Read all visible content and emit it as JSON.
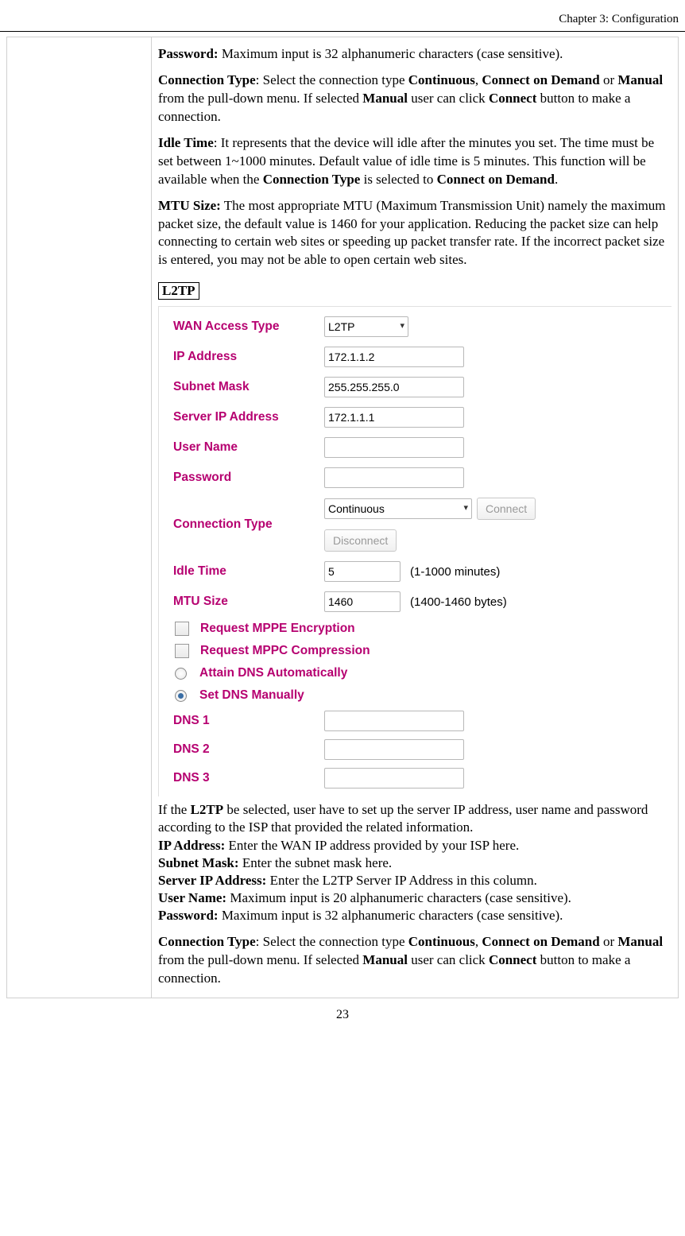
{
  "header": {
    "chapter": "Chapter 3: Configuration"
  },
  "top": {
    "password": {
      "label": "Password:",
      "text": " Maximum input is 32 alphanumeric characters (case sensitive)."
    },
    "conn_type": {
      "label": "Connection Type",
      "t1": ": Select the connection type ",
      "b1": "Continuous",
      "t2": ", ",
      "b2": "Connect on Demand",
      "t3": " or ",
      "b3": "Manual",
      "t4": " from the pull-down menu. If selected ",
      "b4": "Manual",
      "t5": " user can click ",
      "b5": "Connect",
      "t6": " button to make a connection."
    },
    "idle": {
      "label": "Idle Time",
      "t1": ": It represents that the device will idle after the minutes you set. The time must be set between 1~1000 minutes. Default value of idle time is 5 minutes. This function will be available when the ",
      "b1": "Connection Type",
      "t2": " is selected to ",
      "b2": "Connect on Demand",
      "t3": "."
    },
    "mtu": {
      "label": "MTU Size:",
      "t1": " The most appropriate MTU (Maximum Transmission Unit) namely the maximum packet size, the default value is 1460 for your application. Reducing the packet size can help connecting to certain web sites or speeding up packet transfer rate. If the incorrect packet size is entered, you may not be able to open certain web sites."
    }
  },
  "section": "L2TP",
  "form": {
    "wan_access": {
      "label": "WAN Access Type",
      "value": "L2TP"
    },
    "ip": {
      "label": "IP Address",
      "value": "172.1.1.2"
    },
    "subnet": {
      "label": "Subnet Mask",
      "value": "255.255.255.0"
    },
    "server_ip": {
      "label": "Server IP Address",
      "value": "172.1.1.1"
    },
    "user": {
      "label": "User Name",
      "value": ""
    },
    "pass": {
      "label": "Password",
      "value": ""
    },
    "conn_type": {
      "label": "Connection Type",
      "value": "Continuous",
      "connect": "Connect",
      "disconnect": "Disconnect"
    },
    "idle": {
      "label": "Idle Time",
      "value": "5",
      "hint": "(1-1000 minutes)"
    },
    "mtu": {
      "label": "MTU Size",
      "value": "1460",
      "hint": "(1400-1460 bytes)"
    },
    "opt_mppe": {
      "label": "Request MPPE Encryption"
    },
    "opt_mppc": {
      "label": "Request MPPC Compression"
    },
    "opt_auto": {
      "label": "Attain DNS Automatically"
    },
    "opt_manual": {
      "label": "Set DNS Manually"
    },
    "dns1": {
      "label": "DNS 1",
      "value": ""
    },
    "dns2": {
      "label": "DNS 2",
      "value": ""
    },
    "dns3": {
      "label": "DNS 3",
      "value": ""
    }
  },
  "bottom": {
    "intro": {
      "t1": "If the ",
      "b1": "L2TP",
      "t2": " be selected, user have to set up the server IP address, user name and password according to the ISP that provided the related information."
    },
    "ip": {
      "label": "IP Address:",
      "text": " Enter the WAN IP address provided by your ISP here."
    },
    "subnet": {
      "label": "Subnet Mask:",
      "text": " Enter the subnet mask here."
    },
    "server": {
      "label": "Server IP Address:",
      "text": " Enter the L2TP Server IP Address in this column."
    },
    "user": {
      "label": "User Name:",
      "text": " Maximum input is 20 alphanumeric characters (case sensitive)."
    },
    "pass": {
      "label": "Password:",
      "text": " Maximum input is 32 alphanumeric characters (case sensitive)."
    },
    "conn_type": {
      "label": "Connection Type",
      "t1": ": Select the connection type ",
      "b1": "Continuous",
      "t2": ", ",
      "b2": "Connect on Demand",
      "t3": " or ",
      "b3": "Manual",
      "t4": " from the pull-down menu. If selected ",
      "b4": "Manual",
      "t5": " user can click ",
      "b5": "Connect",
      "t6": " button to make a connection."
    }
  },
  "page": "23"
}
